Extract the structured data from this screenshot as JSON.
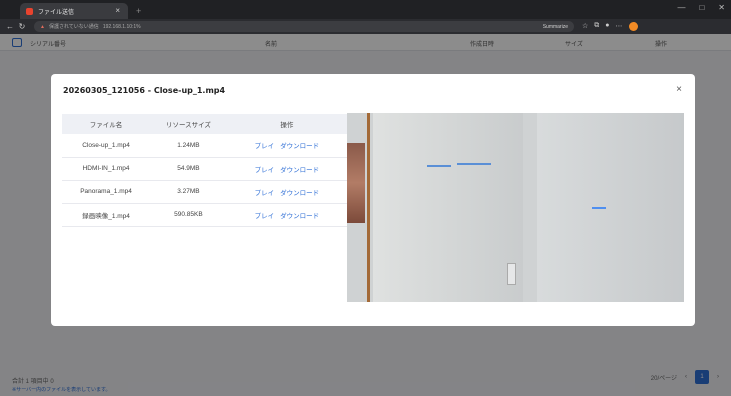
{
  "browser": {
    "tab_title": "ファイル送信",
    "address_warning": "保護されていない通信",
    "address_url": "192.168.1.10:1%",
    "address_zoom": "Summarize",
    "window_controls": [
      "—",
      "□",
      "✕"
    ]
  },
  "app": {
    "header_columns": [
      "シリアル番号",
      "名前",
      "作成日時",
      "サイズ",
      "操作"
    ],
    "footer_total": "合計 1 項目中 0",
    "footer_note": "※サーバー内のファイルを表示しています。",
    "pager_size": "20/ページ",
    "pager_current": "1"
  },
  "modal": {
    "title": "20260305_121056 - Close-up_1.mp4",
    "close": "×",
    "table": {
      "headers": [
        "ファイル名",
        "リソースサイズ",
        "操作"
      ],
      "rows": [
        {
          "name": "Close-up_1.mp4",
          "size": "1.24MB",
          "play": "プレイ",
          "download": "ダウンロード"
        },
        {
          "name": "HDMI-IN_1.mp4",
          "size": "54.9MB",
          "play": "プレイ",
          "download": "ダウンロード"
        },
        {
          "name": "Panorama_1.mp4",
          "size": "3.27MB",
          "play": "プレイ",
          "download": "ダウンロード"
        },
        {
          "name": "録画映像_1.mp4",
          "size": "590.85KB",
          "play": "プレイ",
          "download": "ダウンロード"
        }
      ]
    }
  }
}
